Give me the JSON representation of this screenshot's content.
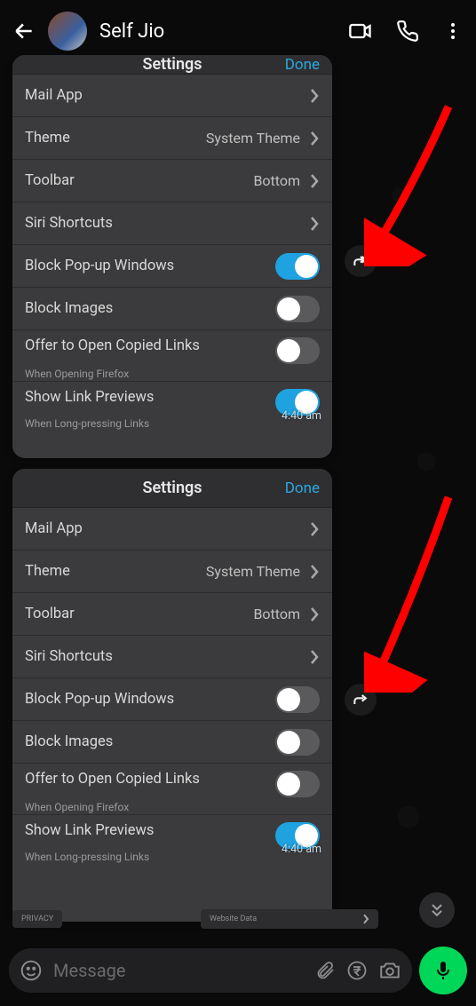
{
  "header": {
    "contact_name": "Self Jio"
  },
  "messages": [
    {
      "settings_title": "Settings",
      "done_label": "Done",
      "timestamp": "4:40 am",
      "rows": {
        "mail": {
          "label": "Mail App"
        },
        "theme": {
          "label": "Theme",
          "value": "System Theme"
        },
        "toolbar": {
          "label": "Toolbar",
          "value": "Bottom"
        },
        "siri": {
          "label": "Siri Shortcuts"
        },
        "popup": {
          "label": "Block Pop-up Windows",
          "on": true
        },
        "images": {
          "label": "Block Images",
          "on": false
        },
        "copied": {
          "label": "Offer to Open Copied Links",
          "sub": "When Opening Firefox",
          "on": false
        },
        "preview": {
          "label": "Show Link Previews",
          "sub": "When Long-pressing Links",
          "on": true
        }
      }
    },
    {
      "settings_title": "Settings",
      "done_label": "Done",
      "timestamp": "4:40 am",
      "rows": {
        "mail": {
          "label": "Mail App"
        },
        "theme": {
          "label": "Theme",
          "value": "System Theme"
        },
        "toolbar": {
          "label": "Toolbar",
          "value": "Bottom"
        },
        "siri": {
          "label": "Siri Shortcuts"
        },
        "popup": {
          "label": "Block Pop-up Windows",
          "on": false
        },
        "images": {
          "label": "Block Images",
          "on": false
        },
        "copied": {
          "label": "Offer to Open Copied Links",
          "sub": "When Opening Firefox",
          "on": false
        },
        "preview": {
          "label": "Show Link Previews",
          "sub": "When Long-pressing Links",
          "on": true
        }
      }
    }
  ],
  "ministrip": {
    "privacy": "PRIVACY",
    "website_data": "Website Data"
  },
  "input": {
    "placeholder": "Message"
  }
}
